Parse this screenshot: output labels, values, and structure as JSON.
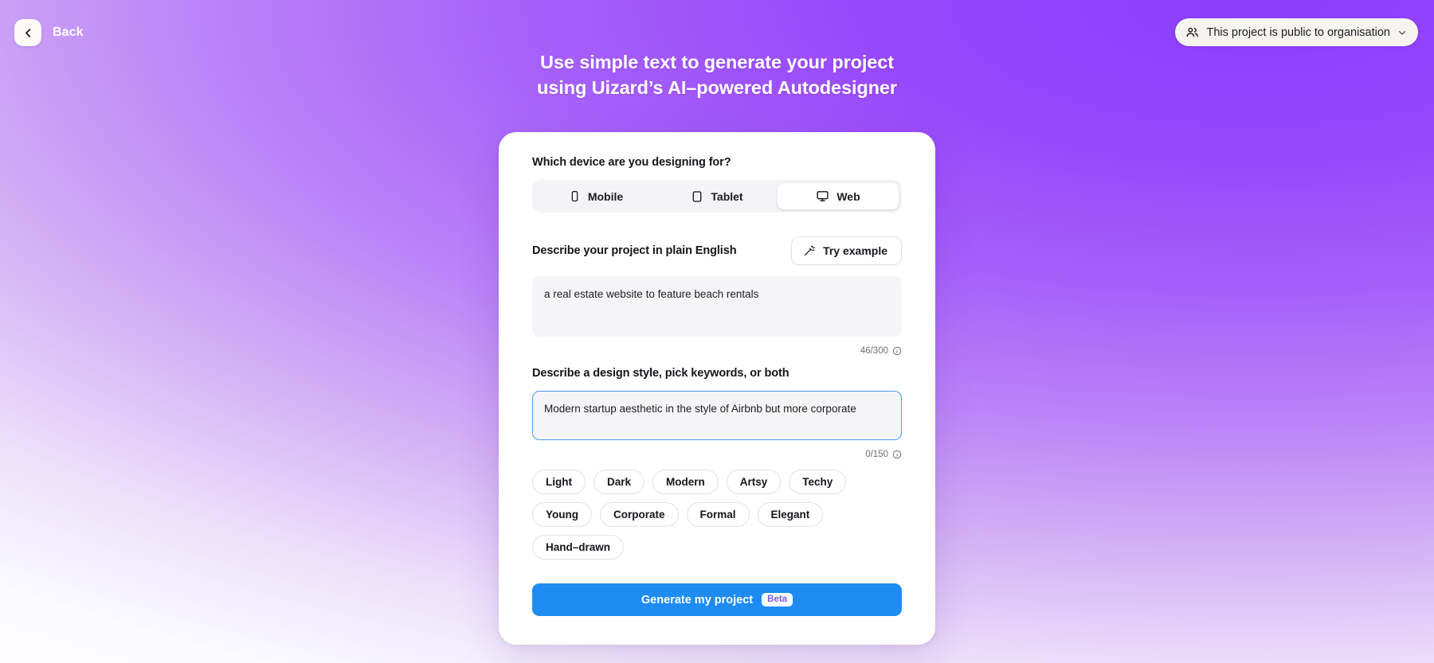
{
  "topbar": {
    "back_label": "Back",
    "back_icon": "chevron-left-icon",
    "visibility_label": "This project is public to organisation",
    "visibility_icon": "users-icon",
    "visibility_chevron": "chevron-down-icon"
  },
  "headline": {
    "line1": "Use simple text to generate your project",
    "line2": "using Uizard’s AI–powered Autodesigner"
  },
  "card": {
    "device_question": "Which device are you designing for?",
    "devices": [
      {
        "label": "Mobile",
        "icon": "phone-icon",
        "selected": false
      },
      {
        "label": "Tablet",
        "icon": "tablet-icon",
        "selected": false
      },
      {
        "label": "Web",
        "icon": "monitor-icon",
        "selected": true
      }
    ],
    "describe_label": "Describe your project in plain English",
    "try_example_label": "Try example",
    "try_example_icon": "magic-wand-icon",
    "project_textarea": {
      "value": "a real estate website to feature beach rentals",
      "counter": "46/300",
      "info_icon": "info-circle-icon"
    },
    "style_label": "Describe a design style, pick keywords, or both",
    "style_textarea": {
      "placeholder": "Modern startup aesthetic in the style of Airbnb but more corporate",
      "value": "",
      "counter": "0/150",
      "info_icon": "info-circle-icon",
      "focused": true
    },
    "keywords": [
      "Light",
      "Dark",
      "Modern",
      "Artsy",
      "Techy",
      "Young",
      "Corporate",
      "Formal",
      "Elegant",
      "Hand–drawn"
    ],
    "cta": {
      "label": "Generate my project",
      "badge": "Beta",
      "color": "#1f8cf3",
      "badge_text_color": "#7a5cf0"
    }
  },
  "colors": {
    "gradient_from": "#8b3dfb",
    "gradient_to": "#ffffff",
    "accent_blue": "#1f8cf3",
    "focus_border": "#4a9df0"
  }
}
